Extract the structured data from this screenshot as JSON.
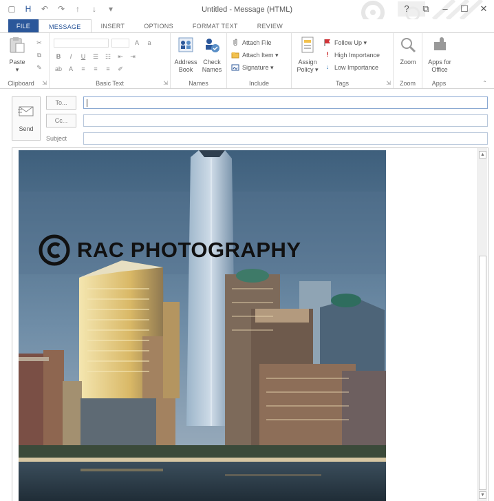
{
  "window": {
    "title": "Untitled - Message (HTML)",
    "controls": {
      "help": "?",
      "restore": "⧉",
      "minimize": "–",
      "maximize": "☐",
      "close": "✕"
    }
  },
  "quick_access": {
    "save": "H",
    "undo": "↶",
    "redo": "↷",
    "up": "↑",
    "down": "↓",
    "more": "▾"
  },
  "tabs": [
    {
      "label": "FILE"
    },
    {
      "label": "MESSAGE"
    },
    {
      "label": "INSERT"
    },
    {
      "label": "OPTIONS"
    },
    {
      "label": "FORMAT TEXT"
    },
    {
      "label": "REVIEW"
    }
  ],
  "ribbon": {
    "clipboard": {
      "label": "Clipboard",
      "paste": "Paste",
      "launcher": "⇲"
    },
    "basic_text": {
      "label": "Basic Text",
      "launcher": "⇲"
    },
    "names": {
      "label": "Names",
      "address_book": "Address Book",
      "check_names": "Check Names"
    },
    "include": {
      "label": "Include",
      "attach_file": "Attach File",
      "attach_item": "Attach Item ▾",
      "signature": "Signature ▾"
    },
    "tags": {
      "label": "Tags",
      "assign_policy": "Assign Policy ▾",
      "follow_up": "Follow Up ▾",
      "high_importance": "High Importance",
      "low_importance": "Low Importance",
      "launcher": "⇲"
    },
    "zoom": {
      "label": "Zoom",
      "zoom": "Zoom"
    },
    "apps": {
      "label": "Apps",
      "apps_for_office": "Apps for Office"
    },
    "collapse": "⌃"
  },
  "compose": {
    "send": "Send",
    "to_button": "To...",
    "cc_button": "Cc...",
    "subject_label": "Subject",
    "to_value": "",
    "cc_value": "",
    "subject_value": ""
  },
  "body": {
    "watermark": "RAC PHOTOGRAPHY"
  },
  "colors": {
    "accent": "#2b579a",
    "flag_red": "#d13438",
    "importance_red": "#c00000",
    "low_blue": "#2e75b6"
  }
}
